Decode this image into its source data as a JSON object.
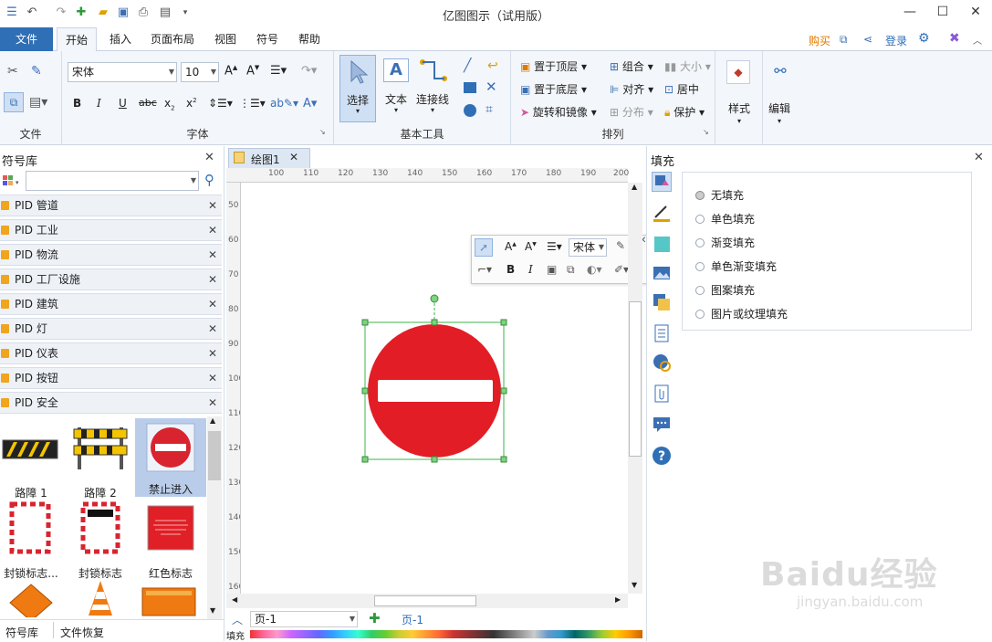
{
  "app": {
    "title": "亿图图示（试用版）"
  },
  "menu": {
    "tabs": [
      "文件",
      "开始",
      "插入",
      "页面布局",
      "视图",
      "符号",
      "帮助"
    ],
    "buy": "购买",
    "login": "登录"
  },
  "ribbon": {
    "group_file": "文件",
    "group_font": "字体",
    "group_tools": "基本工具",
    "group_arrange": "排列",
    "font_name": "宋体",
    "font_size": "10",
    "select": "选择",
    "text": "文本",
    "connector": "连接线",
    "bring_top": "置于顶层",
    "send_bottom": "置于底层",
    "rotate": "旋转和镜像",
    "group_btn": "组合",
    "align": "对齐",
    "distribute": "分布",
    "size": "大小",
    "center": "居中",
    "protect": "保护",
    "style": "样式",
    "edit": "编辑"
  },
  "library": {
    "title": "符号库",
    "items": [
      "PID 管道",
      "PID 工业",
      "PID 物流",
      "PID 工厂设施",
      "PID 建筑",
      "PID 灯",
      "PID 仪表",
      "PID 按钮",
      "PID 安全"
    ],
    "symbols": [
      "路障 1",
      "路障 2",
      "禁止进入",
      "封锁标志...",
      "封锁标志",
      "红色标志"
    ],
    "bottom_tabs": [
      "符号库",
      "文件恢复"
    ]
  },
  "document": {
    "tab": "绘图1",
    "page_selector": "页-1",
    "page_tab": "页-1",
    "fill_label": "填充",
    "hruler": [
      "100",
      "110",
      "120",
      "130",
      "140",
      "150",
      "160",
      "170",
      "180",
      "190",
      "200"
    ],
    "vruler": [
      "50",
      "60",
      "70",
      "80",
      "90",
      "100",
      "110",
      "120",
      "130",
      "140",
      "150",
      "160"
    ],
    "minitoolbar_font": "宋体"
  },
  "fill_panel": {
    "title": "填充",
    "options": [
      "无填充",
      "单色填充",
      "渐变填充",
      "单色渐变填充",
      "图案填充",
      "图片或纹理填充"
    ]
  },
  "watermark": {
    "line1": "Baidu经验",
    "line2": "jingyan.baidu.com"
  }
}
